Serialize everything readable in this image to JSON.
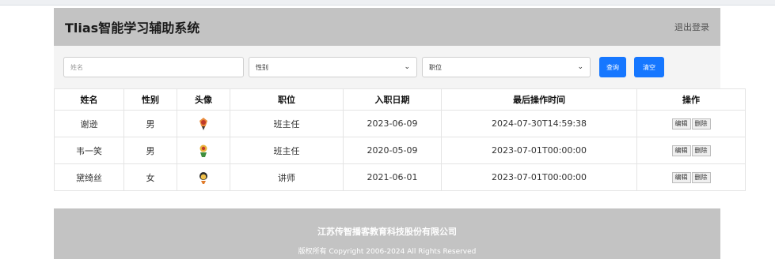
{
  "app": {
    "title": "Tlias智能学习辅助系统",
    "logout_label": "退出登录"
  },
  "search": {
    "name_placeholder": "姓名",
    "gender_placeholder": "性别",
    "job_placeholder": "职位",
    "query_label": "查询",
    "clear_label": "清空"
  },
  "table": {
    "headers": {
      "name": "姓名",
      "gender": "性别",
      "avatar": "头像",
      "job": "职位",
      "entry_date": "入职日期",
      "update_time": "最后操作时间",
      "actions": "操作"
    },
    "rows": [
      {
        "name": "谢逊",
        "gender": "男",
        "avatar": "avatar-icon",
        "job": "班主任",
        "entry_date": "2023-06-09",
        "update_time": "2024-07-30T14:59:38",
        "edit": "编辑",
        "delete": "删除"
      },
      {
        "name": "韦一笑",
        "gender": "男",
        "avatar": "avatar-icon",
        "job": "班主任",
        "entry_date": "2020-05-09",
        "update_time": "2023-07-01T00:00:00",
        "edit": "编辑",
        "delete": "删除"
      },
      {
        "name": "黛绮丝",
        "gender": "女",
        "avatar": "avatar-icon",
        "job": "讲师",
        "entry_date": "2021-06-01",
        "update_time": "2023-07-01T00:00:00",
        "edit": "编辑",
        "delete": "删除"
      }
    ]
  },
  "footer": {
    "company": "江苏传智播客教育科技股份有限公司",
    "copyright": "版权所有 Copyright 2006-2024 All Rights Reserved"
  },
  "colors": {
    "header_bg": "#c3c3c3",
    "accent": "#1677ff"
  }
}
